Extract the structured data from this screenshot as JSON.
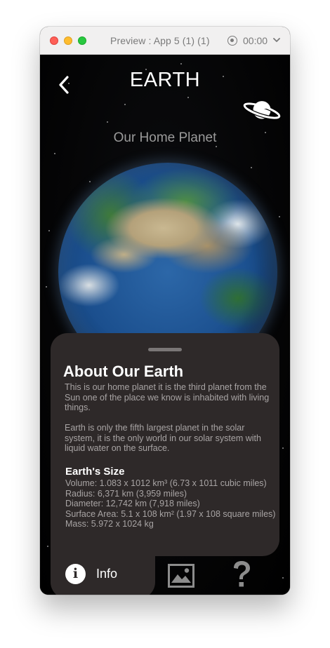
{
  "window": {
    "title": "Preview : App 5 (1) (1)",
    "timer": "00:00"
  },
  "header": {
    "title": "EARTH",
    "subtitle": "Our Home Planet"
  },
  "about": {
    "title": "About Our Earth",
    "paragraph1": "This is our home planet it is the third planet from the Sun one of the place we know is inhabited with living things.",
    "paragraph2": "Earth is only the fifth largest planet in the solar system, it is the only world in our solar system with liquid water on the surface."
  },
  "size": {
    "title": "Earth's Size",
    "lines": [
      "Volume: 1.083 x 1012 km³ (6.73 x 1011 cubic miles)",
      "Radius: 6,371 km (3,959 miles)",
      "Diameter: 12,742 km (7,918 miles)",
      "Surface Area: 5.1 x 108 km² (1.97 x 108 square miles)",
      "Mass: 5.972 x 1024 kg"
    ]
  },
  "tabs": {
    "info_label": "Info",
    "info_icon_glyph": "i",
    "active": "info",
    "icons": [
      "info-icon",
      "gallery-icon",
      "question-icon"
    ]
  },
  "colors": {
    "background": "#000000",
    "panel": "#2e2929",
    "title_text": "#ffffff",
    "body_text": "#a8a4a4",
    "subtitle_text": "#9a9a9a"
  }
}
